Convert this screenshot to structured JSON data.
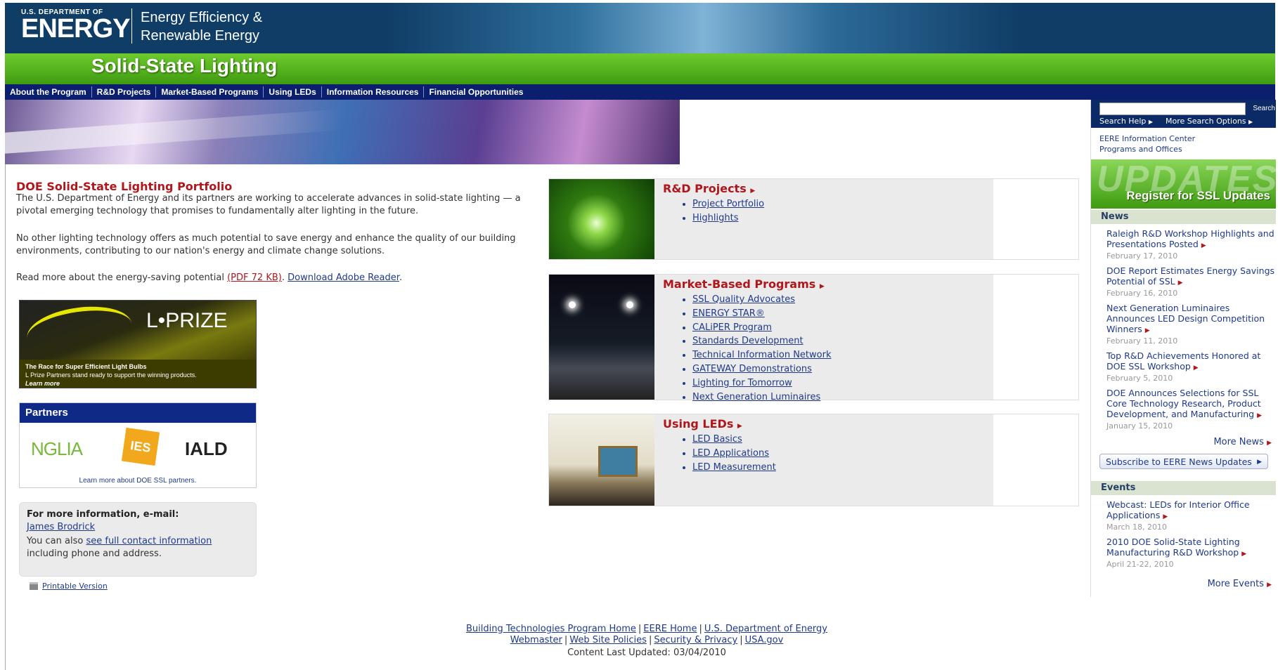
{
  "header": {
    "doe_small": "U.S. DEPARTMENT OF",
    "doe_big": "ENERGY",
    "eere_line1": "Energy Efficiency &",
    "eere_line2": "Renewable Energy",
    "site_title": "Solid-State Lighting"
  },
  "nav": {
    "items": [
      {
        "label": "About the Program"
      },
      {
        "label": "R&D Projects"
      },
      {
        "label": "Market-Based Programs"
      },
      {
        "label": "Using LEDs"
      },
      {
        "label": "Information Resources"
      },
      {
        "label": "Financial Opportunities"
      }
    ]
  },
  "intro": {
    "title": "DOE Solid-State Lighting Portfolio",
    "p1": "The U.S. Department of Energy and its partners are working to accelerate advances in solid-state lighting — a pivotal emerging technology that promises to fundamentally alter lighting in the future.",
    "p2": "No other lighting technology offers as much potential to save energy and enhance the quality of our building environments, contributing to our nation's energy and climate change solutions.",
    "p3_prefix": "Read more about the energy-saving potential ",
    "p3_pdf": "(PDF 72 KB)",
    "p3_sep": ". ",
    "p3_reader": "Download Adobe Reader",
    "p3_end": "."
  },
  "lprize": {
    "logo": "L•PRIZE",
    "tagline": "The Race for Super Efficient Light Bulbs",
    "subtitle": "L Prize Partners stand ready to support the winning products.",
    "learn_more": "Learn more"
  },
  "partners": {
    "title": "Partners",
    "logo1": "NGLIA",
    "logo2": "IES",
    "logo3": "IALD",
    "more": "Learn more about DOE SSL partners."
  },
  "contact": {
    "title": "For more information, e-mail:",
    "name": "James Brodrick",
    "also": "You can also ",
    "link": "see full contact information",
    "suffix": " including phone and address."
  },
  "printable": "Printable Version",
  "programs": {
    "rd": {
      "title": "R&D Projects",
      "links": [
        "Project Portfolio",
        "Highlights"
      ]
    },
    "mb": {
      "title": "Market-Based Programs",
      "links": [
        "SSL Quality Advocates",
        "ENERGY STAR®",
        "CALiPER Program",
        "Standards Development",
        "Technical Information Network",
        "GATEWAY Demonstrations",
        "Lighting for Tomorrow",
        "Next Generation Luminaires"
      ]
    },
    "led": {
      "title": "Using LEDs",
      "links": [
        "LED Basics",
        "LED Applications",
        "LED Measurement"
      ]
    }
  },
  "sidebar": {
    "search_button": "Search",
    "search_help": "Search Help",
    "more_options": "More Search Options",
    "eere_info_line1": "EERE Information Center",
    "eere_info_line2": "Programs and Offices",
    "updates_bg": "UPDATES",
    "updates_label": "Register for SSL Updates",
    "news_title": "News",
    "news": [
      {
        "title": "Raleigh R&D Workshop Highlights and Presentations Posted",
        "date": "February 17, 2010"
      },
      {
        "title": "DOE Report Estimates Energy Savings Potential of SSL",
        "date": "February 16, 2010"
      },
      {
        "title": "Next Generation Luminaires Announces LED Design Competition Winners",
        "date": "February 11, 2010"
      },
      {
        "title": "Top R&D Achievements Honored at DOE SSL Workshop",
        "date": "February 5, 2010"
      },
      {
        "title": "DOE Announces Selections for SSL Core Technology Research, Product Development, and Manufacturing",
        "date": "January 15, 2010"
      }
    ],
    "more_news": "More News",
    "subscribe": "Subscribe to EERE News Updates",
    "events_title": "Events",
    "events": [
      {
        "title": "Webcast: LEDs for Interior Office Applications",
        "date": "March 18, 2010"
      },
      {
        "title": "2010 DOE Solid-State Lighting Manufacturing R&D Workshop",
        "date": "April 21-22, 2010"
      }
    ],
    "more_events": "More Events"
  },
  "footer": {
    "link1": "Building Technologies Program Home",
    "link2": "EERE Home",
    "link3": "U.S. Department of Energy",
    "link4": "Webmaster",
    "link5": "Web Site Policies",
    "link6": "Security & Privacy",
    "link7": "USA.gov",
    "updated": "Content Last Updated: 03/04/2010"
  }
}
